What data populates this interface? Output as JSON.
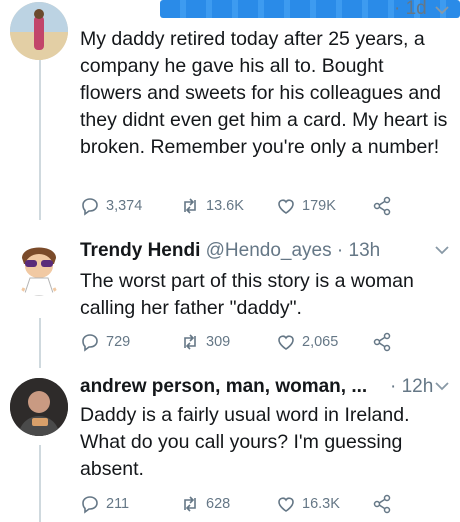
{
  "tweets": [
    {
      "name": "",
      "handle": "",
      "time": "1d",
      "text": "My daddy retired today after 25 years, a company he gave his all to. Bought flowers and sweets for his colleagues and they didnt even get him a card. My heart is broken. Remember you're only a number!",
      "replies": "3,374",
      "retweets": "13.6K",
      "likes": "179K"
    },
    {
      "name": "Trendy Hendi",
      "handle": "@Hendo_ayes",
      "time": "13h",
      "text": "The worst part of this story is a woman calling her father \"daddy\".",
      "replies": "729",
      "retweets": "309",
      "likes": "2,065"
    },
    {
      "name": "andrew person, man, woman, ...",
      "handle": "",
      "time": "12h",
      "text": "Daddy is a fairly usual word in Ireland. What do you call yours? I'm guessing absent.",
      "replies": "211",
      "retweets": "628",
      "likes": "16.3K"
    }
  ],
  "separator": "·",
  "colors": {
    "text": "#14171a",
    "muted": "#657786",
    "line": "#cfd9de",
    "redaction": "#2a8be8"
  }
}
